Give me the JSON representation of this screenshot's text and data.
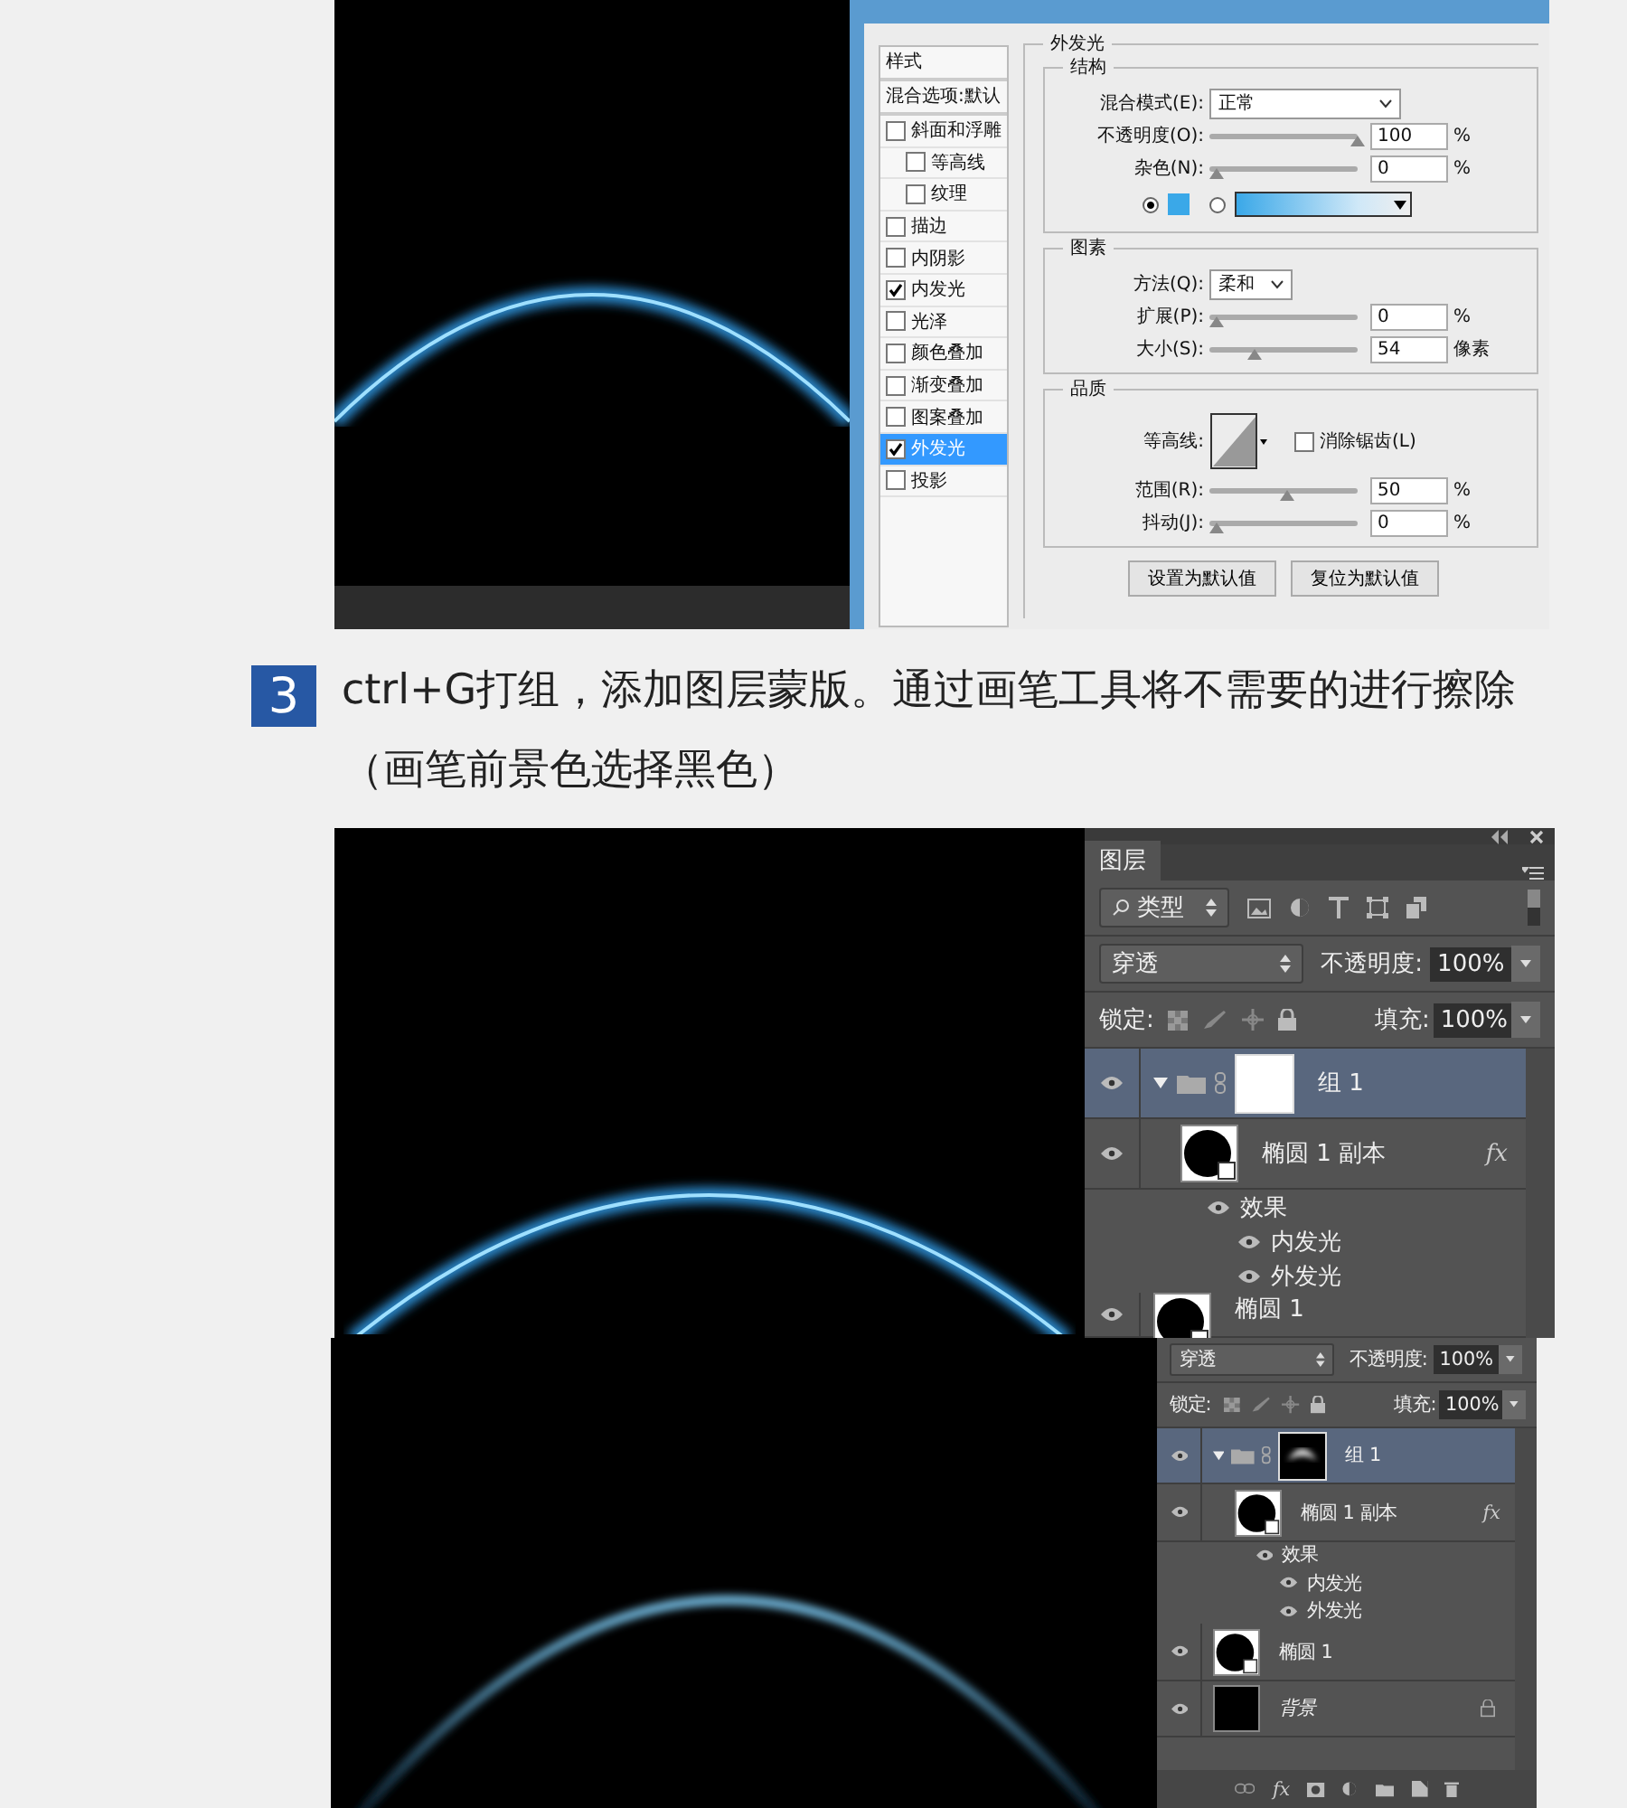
{
  "figure_1": {
    "layer_style_dialog": {
      "styles_header": "样式",
      "blend_options": "混合选项:默认",
      "styles": [
        {
          "label": "斜面和浮雕",
          "checked": false,
          "selected": false,
          "children": [
            {
              "label": "等高线",
              "checked": false,
              "selected": false
            },
            {
              "label": "纹理",
              "checked": false,
              "selected": false
            }
          ]
        },
        {
          "label": "描边",
          "checked": false,
          "selected": false
        },
        {
          "label": "内阴影",
          "checked": false,
          "selected": false
        },
        {
          "label": "内发光",
          "checked": true,
          "selected": false
        },
        {
          "label": "光泽",
          "checked": false,
          "selected": false
        },
        {
          "label": "颜色叠加",
          "checked": false,
          "selected": false
        },
        {
          "label": "渐变叠加",
          "checked": false,
          "selected": false
        },
        {
          "label": "图案叠加",
          "checked": false,
          "selected": false
        },
        {
          "label": "外发光",
          "checked": true,
          "selected": true
        },
        {
          "label": "投影",
          "checked": false,
          "selected": false
        }
      ],
      "outer_glow": {
        "title": "外发光",
        "structure": {
          "title": "结构",
          "blend_mode": {
            "label": "混合模式(E):",
            "value": "正常"
          },
          "sliders": [
            {
              "label": "不透明度(O):",
              "level": 1,
              "value": "100",
              "unit": "%"
            },
            {
              "label": "杂色(N):",
              "level": 0,
              "value": "0",
              "unit": "%"
            }
          ],
          "fill_options": [
            {
              "kind": "color",
              "selected": true
            },
            {
              "kind": "gradient",
              "selected": false
            }
          ]
        },
        "elements": {
          "title": "图素",
          "technique": {
            "label": "方法(Q):",
            "value": "柔和"
          },
          "sliders": [
            {
              "label": "扩展(P):",
              "level": 0,
              "value": "0",
              "unit": "%"
            },
            {
              "label": "大小(S):",
              "level": 0.27,
              "value": "54",
              "unit": "像素"
            }
          ]
        },
        "quality": {
          "title": "品质",
          "contour": {
            "label": "等高线:"
          },
          "anti_alias": {
            "label": "消除锯齿(L)",
            "checked": false
          },
          "sliders": [
            {
              "label": "范围(R):",
              "level": 0.5,
              "value": "50",
              "unit": "%"
            },
            {
              "label": "抖动(J):",
              "level": 0,
              "value": "0",
              "unit": "%"
            }
          ]
        },
        "buttons": [
          "设置为默认值",
          "复位为默认值"
        ]
      }
    }
  },
  "step": {
    "number": "3",
    "text": "ctrl+G打组，添加图层蒙版。通过画笔工具将不需要的进行擦除（画笔前景色选择黑色）"
  },
  "figure_2": {
    "layers_panel": {
      "tab": "图层",
      "filter": "类型",
      "blend_mode": "穿透",
      "opacity_label": "不透明度:",
      "opacity": "100%",
      "lock_label": "锁定:",
      "fill_label": "填充:",
      "fill": "100%",
      "layers": [
        {
          "name": "组 1",
          "kind": "group",
          "selected": true,
          "expanded": true,
          "children": [
            {
              "name": "椭圆 1 副本",
              "kind": "shape",
              "fx": "fx",
              "effects_label": "效果",
              "effects": [
                "内发光",
                "外发光"
              ]
            }
          ]
        },
        {
          "name": "椭圆 1",
          "kind": "shape"
        }
      ]
    }
  },
  "figure_3": {
    "layers_panel": {
      "blend_mode": "穿透",
      "opacity_label": "不透明度:",
      "opacity": "100%",
      "lock_label": "锁定:",
      "fill_label": "填充:",
      "fill": "100%",
      "layers": [
        {
          "name": "组 1",
          "kind": "group",
          "selected": true,
          "expanded": true,
          "children": [
            {
              "name": "椭圆 1 副本",
              "kind": "shape",
              "fx": "fx",
              "effects_label": "效果",
              "effects": [
                "内发光",
                "外发光"
              ]
            }
          ]
        },
        {
          "name": "椭圆 1",
          "kind": "shape"
        },
        {
          "name": "背景",
          "kind": "background",
          "locked": true
        }
      ],
      "footer_fx": "fx"
    }
  }
}
